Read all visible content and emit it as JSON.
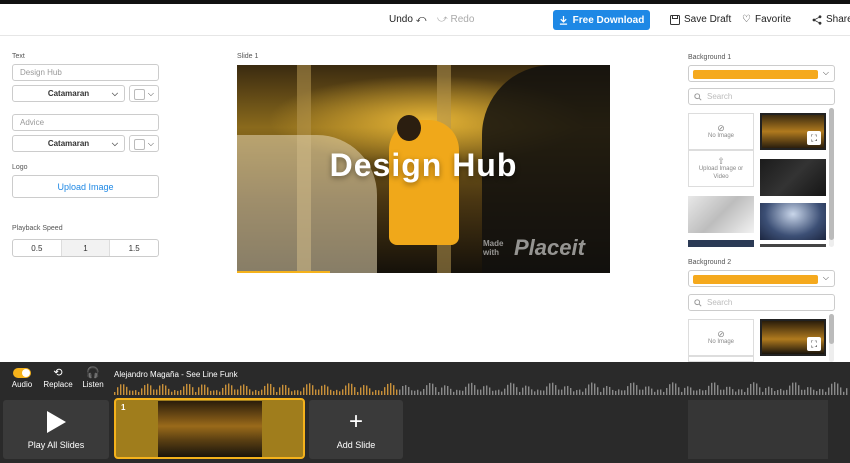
{
  "topbar": {
    "undo": "Undo",
    "redo": "Redo",
    "download": "Free Download",
    "save_draft": "Save Draft",
    "favorite": "Favorite",
    "share": "Share"
  },
  "left_panel": {
    "text_label": "Text",
    "text1_placeholder": "Design Hub",
    "font1": "Catamaran",
    "text2_placeholder": "Advice",
    "font2": "Catamaran",
    "logo_label": "Logo",
    "upload_label": "Upload Image",
    "speed_label": "Playback Speed",
    "speed_options": [
      "0.5",
      "1",
      "1.5"
    ],
    "speed_selected": "1"
  },
  "canvas": {
    "slide_label": "Slide 1",
    "headline": "Design Hub",
    "watermark_small1": "Made",
    "watermark_small2": "with",
    "watermark_brand": "Placeit"
  },
  "right_panel": {
    "bg1_label": "Background 1",
    "bg2_label": "Background 2",
    "search_placeholder": "Search",
    "no_image": "No Image",
    "upload_image_line1": "Upload Image or",
    "upload_image_line2": "Video",
    "accent_color": "#f5a91d"
  },
  "bottom": {
    "audio": "Audio",
    "replace": "Replace",
    "listen": "Listen",
    "track": "Alejandro Magaña - See Line Funk",
    "play_all": "Play All Slides",
    "slide_number": "1",
    "add_slide": "Add Slide"
  },
  "colors": {
    "primary_blue": "#1e88e5",
    "accent_yellow": "#f5b21b",
    "timeline_bg": "#2a2a2a"
  }
}
